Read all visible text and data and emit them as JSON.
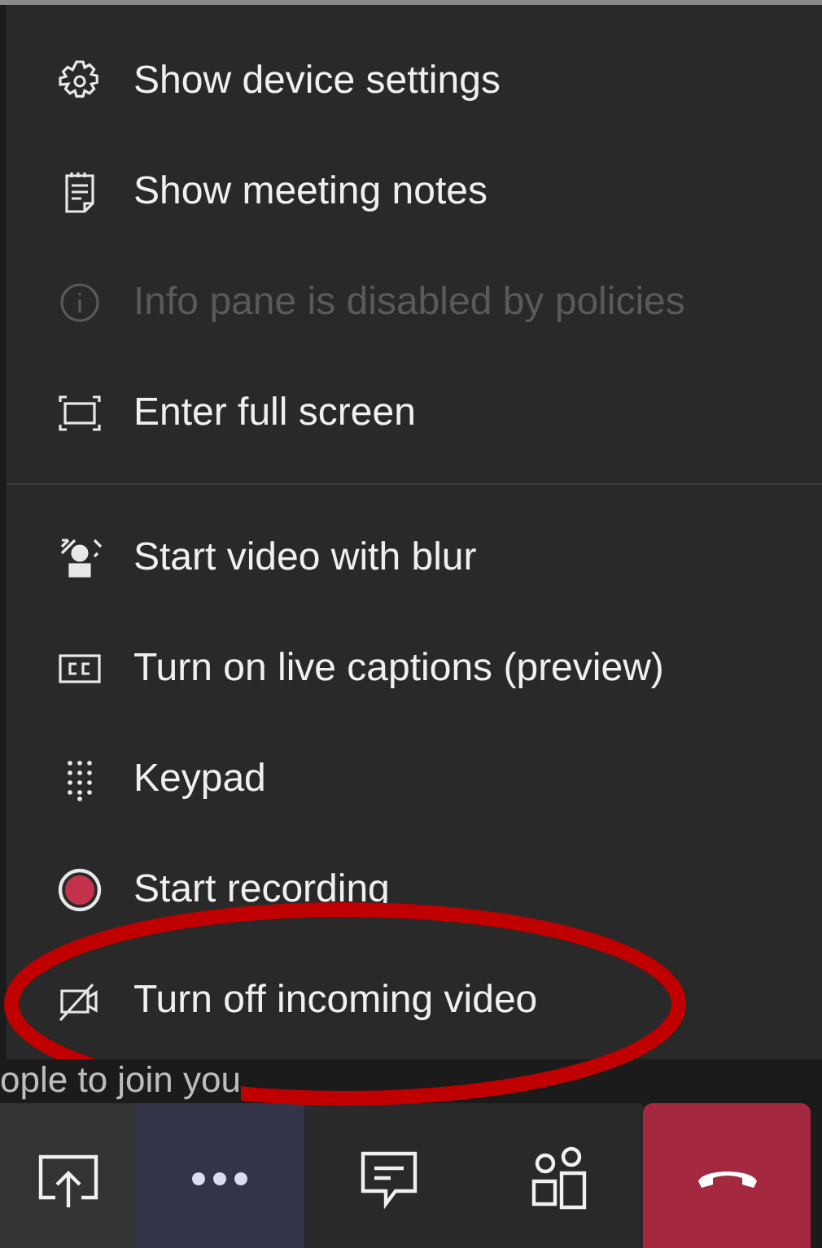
{
  "menu_sections": [
    [
      {
        "kind": "settings",
        "label": "Show device settings",
        "disabled": false
      },
      {
        "kind": "notes",
        "label": "Show meeting notes",
        "disabled": false
      },
      {
        "kind": "info",
        "label": "Info pane is disabled by policies",
        "disabled": true
      },
      {
        "kind": "fullscreen",
        "label": "Enter full screen",
        "disabled": false
      }
    ],
    [
      {
        "kind": "blur",
        "label": "Start video with blur",
        "disabled": false
      },
      {
        "kind": "captions",
        "label": "Turn on live captions (preview)",
        "disabled": false
      },
      {
        "kind": "keypad",
        "label": "Keypad",
        "disabled": false
      },
      {
        "kind": "record",
        "label": "Start recording",
        "disabled": false
      },
      {
        "kind": "video-off",
        "label": "Turn off incoming video",
        "disabled": false
      }
    ]
  ],
  "background_text": "ople to join you",
  "toolbar": [
    {
      "kind": "share",
      "selected": false
    },
    {
      "kind": "more",
      "selected": true
    },
    {
      "kind": "chat",
      "selected": false
    },
    {
      "kind": "people",
      "selected": false
    },
    {
      "kind": "hangup",
      "selected": false
    }
  ]
}
